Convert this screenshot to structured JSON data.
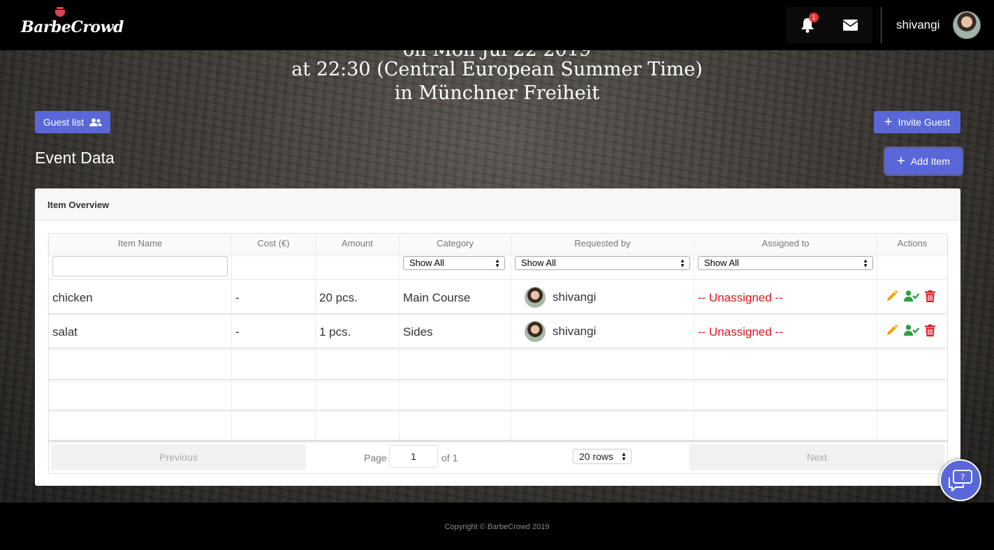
{
  "brand": {
    "name": "BarbeCrowd"
  },
  "navbar": {
    "notifications_count": "1",
    "username": "shivangi"
  },
  "hero": {
    "line1": "on Mon Jul 22 2019",
    "line2": "at 22:30 (Central European Summer Time)",
    "line3": "in Münchner Freiheit"
  },
  "buttons": {
    "guest_list": "Guest list",
    "invite_guest": "Invite Guest",
    "add_item": "Add Item"
  },
  "event_title": "Event Data",
  "card": {
    "title": "Item Overview",
    "columns": [
      "Item Name",
      "Cost (€)",
      "Amount",
      "Category",
      "Requested by",
      "Assigned to",
      "Actions"
    ],
    "filters": {
      "category": "Show All",
      "requested_by": "Show All",
      "assigned_to": "Show All"
    },
    "rows": [
      {
        "item": "chicken",
        "cost": "-",
        "amount": "20 pcs.",
        "category": "Main Course",
        "requested_by": "shivangi",
        "assigned_to": "-- Unassigned --"
      },
      {
        "item": "salat",
        "cost": "-",
        "amount": "1 pcs.",
        "category": "Sides",
        "requested_by": "shivangi",
        "assigned_to": "-- Unassigned --"
      }
    ],
    "pagination": {
      "previous": "Previous",
      "page_label": "Page",
      "page": "1",
      "of_label": "of 1",
      "rows": "20 rows",
      "next": "Next"
    }
  },
  "footer": {
    "copyright": "Copyright © BarbeCrowd 2019"
  },
  "colors": {
    "primary": "#5a67d8",
    "unassigned": "#e3161b",
    "edit": "#f0a30a",
    "assign": "#2f9e44",
    "delete": "#e3161b"
  }
}
